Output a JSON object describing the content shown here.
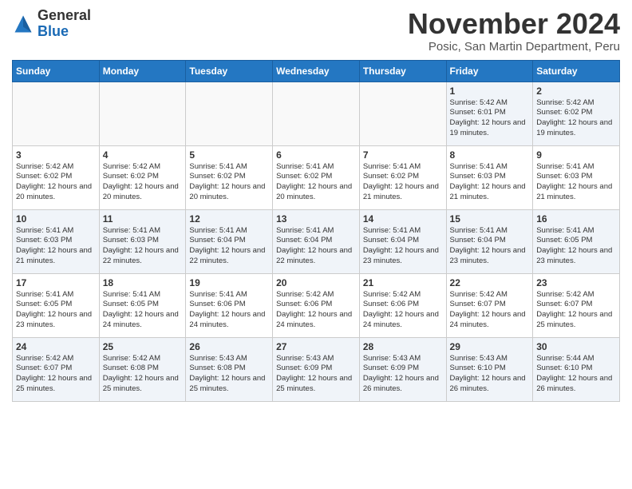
{
  "logo": {
    "general": "General",
    "blue": "Blue"
  },
  "title": "November 2024",
  "location": "Posic, San Martin Department, Peru",
  "headers": [
    "Sunday",
    "Monday",
    "Tuesday",
    "Wednesday",
    "Thursday",
    "Friday",
    "Saturday"
  ],
  "weeks": [
    [
      {
        "day": "",
        "info": ""
      },
      {
        "day": "",
        "info": ""
      },
      {
        "day": "",
        "info": ""
      },
      {
        "day": "",
        "info": ""
      },
      {
        "day": "",
        "info": ""
      },
      {
        "day": "1",
        "info": "Sunrise: 5:42 AM\nSunset: 6:01 PM\nDaylight: 12 hours and 19 minutes."
      },
      {
        "day": "2",
        "info": "Sunrise: 5:42 AM\nSunset: 6:02 PM\nDaylight: 12 hours and 19 minutes."
      }
    ],
    [
      {
        "day": "3",
        "info": "Sunrise: 5:42 AM\nSunset: 6:02 PM\nDaylight: 12 hours and 20 minutes."
      },
      {
        "day": "4",
        "info": "Sunrise: 5:42 AM\nSunset: 6:02 PM\nDaylight: 12 hours and 20 minutes."
      },
      {
        "day": "5",
        "info": "Sunrise: 5:41 AM\nSunset: 6:02 PM\nDaylight: 12 hours and 20 minutes."
      },
      {
        "day": "6",
        "info": "Sunrise: 5:41 AM\nSunset: 6:02 PM\nDaylight: 12 hours and 20 minutes."
      },
      {
        "day": "7",
        "info": "Sunrise: 5:41 AM\nSunset: 6:02 PM\nDaylight: 12 hours and 21 minutes."
      },
      {
        "day": "8",
        "info": "Sunrise: 5:41 AM\nSunset: 6:03 PM\nDaylight: 12 hours and 21 minutes."
      },
      {
        "day": "9",
        "info": "Sunrise: 5:41 AM\nSunset: 6:03 PM\nDaylight: 12 hours and 21 minutes."
      }
    ],
    [
      {
        "day": "10",
        "info": "Sunrise: 5:41 AM\nSunset: 6:03 PM\nDaylight: 12 hours and 21 minutes."
      },
      {
        "day": "11",
        "info": "Sunrise: 5:41 AM\nSunset: 6:03 PM\nDaylight: 12 hours and 22 minutes."
      },
      {
        "day": "12",
        "info": "Sunrise: 5:41 AM\nSunset: 6:04 PM\nDaylight: 12 hours and 22 minutes."
      },
      {
        "day": "13",
        "info": "Sunrise: 5:41 AM\nSunset: 6:04 PM\nDaylight: 12 hours and 22 minutes."
      },
      {
        "day": "14",
        "info": "Sunrise: 5:41 AM\nSunset: 6:04 PM\nDaylight: 12 hours and 23 minutes."
      },
      {
        "day": "15",
        "info": "Sunrise: 5:41 AM\nSunset: 6:04 PM\nDaylight: 12 hours and 23 minutes."
      },
      {
        "day": "16",
        "info": "Sunrise: 5:41 AM\nSunset: 6:05 PM\nDaylight: 12 hours and 23 minutes."
      }
    ],
    [
      {
        "day": "17",
        "info": "Sunrise: 5:41 AM\nSunset: 6:05 PM\nDaylight: 12 hours and 23 minutes."
      },
      {
        "day": "18",
        "info": "Sunrise: 5:41 AM\nSunset: 6:05 PM\nDaylight: 12 hours and 24 minutes."
      },
      {
        "day": "19",
        "info": "Sunrise: 5:41 AM\nSunset: 6:06 PM\nDaylight: 12 hours and 24 minutes."
      },
      {
        "day": "20",
        "info": "Sunrise: 5:42 AM\nSunset: 6:06 PM\nDaylight: 12 hours and 24 minutes."
      },
      {
        "day": "21",
        "info": "Sunrise: 5:42 AM\nSunset: 6:06 PM\nDaylight: 12 hours and 24 minutes."
      },
      {
        "day": "22",
        "info": "Sunrise: 5:42 AM\nSunset: 6:07 PM\nDaylight: 12 hours and 24 minutes."
      },
      {
        "day": "23",
        "info": "Sunrise: 5:42 AM\nSunset: 6:07 PM\nDaylight: 12 hours and 25 minutes."
      }
    ],
    [
      {
        "day": "24",
        "info": "Sunrise: 5:42 AM\nSunset: 6:07 PM\nDaylight: 12 hours and 25 minutes."
      },
      {
        "day": "25",
        "info": "Sunrise: 5:42 AM\nSunset: 6:08 PM\nDaylight: 12 hours and 25 minutes."
      },
      {
        "day": "26",
        "info": "Sunrise: 5:43 AM\nSunset: 6:08 PM\nDaylight: 12 hours and 25 minutes."
      },
      {
        "day": "27",
        "info": "Sunrise: 5:43 AM\nSunset: 6:09 PM\nDaylight: 12 hours and 25 minutes."
      },
      {
        "day": "28",
        "info": "Sunrise: 5:43 AM\nSunset: 6:09 PM\nDaylight: 12 hours and 26 minutes."
      },
      {
        "day": "29",
        "info": "Sunrise: 5:43 AM\nSunset: 6:10 PM\nDaylight: 12 hours and 26 minutes."
      },
      {
        "day": "30",
        "info": "Sunrise: 5:44 AM\nSunset: 6:10 PM\nDaylight: 12 hours and 26 minutes."
      }
    ]
  ]
}
